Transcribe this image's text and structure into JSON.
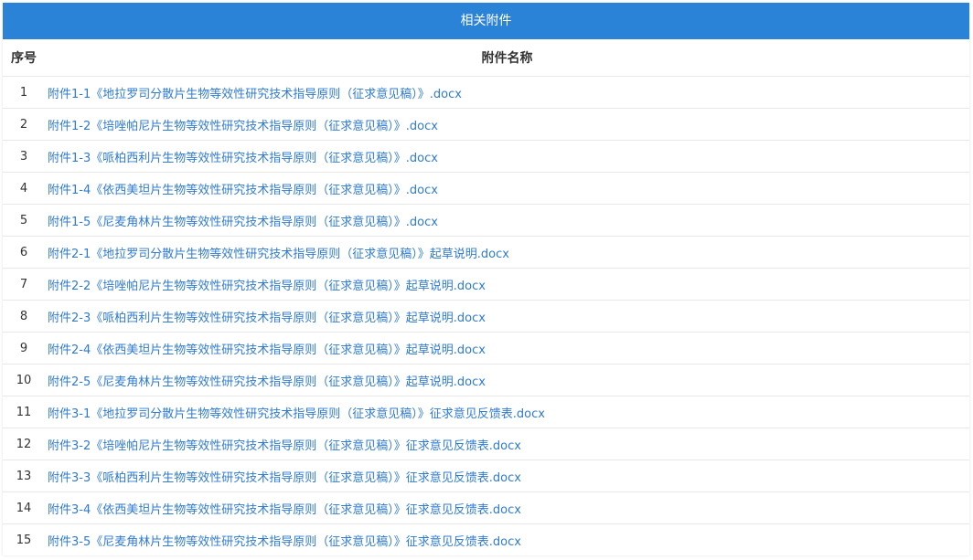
{
  "panel": {
    "title": "相关附件"
  },
  "table": {
    "headers": {
      "number": "序号",
      "name": "附件名称"
    },
    "rows": [
      {
        "number": "1",
        "name": "附件1-1《地拉罗司分散片生物等效性研究技术指导原则（征求意见稿）》.docx"
      },
      {
        "number": "2",
        "name": "附件1-2《培唑帕尼片生物等效性研究技术指导原则（征求意见稿）》.docx"
      },
      {
        "number": "3",
        "name": "附件1-3《哌柏西利片生物等效性研究技术指导原则（征求意见稿）》.docx"
      },
      {
        "number": "4",
        "name": "附件1-4《依西美坦片生物等效性研究技术指导原则（征求意见稿）》.docx"
      },
      {
        "number": "5",
        "name": "附件1-5《尼麦角林片生物等效性研究技术指导原则（征求意见稿）》.docx"
      },
      {
        "number": "6",
        "name": "附件2-1《地拉罗司分散片生物等效性研究技术指导原则（征求意见稿）》起草说明.docx"
      },
      {
        "number": "7",
        "name": "附件2-2《培唑帕尼片生物等效性研究技术指导原则（征求意见稿）》起草说明.docx"
      },
      {
        "number": "8",
        "name": "附件2-3《哌柏西利片生物等效性研究技术指导原则（征求意见稿）》起草说明.docx"
      },
      {
        "number": "9",
        "name": "附件2-4《依西美坦片生物等效性研究技术指导原则（征求意见稿）》起草说明.docx"
      },
      {
        "number": "10",
        "name": "附件2-5《尼麦角林片生物等效性研究技术指导原则（征求意见稿）》起草说明.docx"
      },
      {
        "number": "11",
        "name": "附件3-1《地拉罗司分散片生物等效性研究技术指导原则（征求意见稿）》征求意见反馈表.docx"
      },
      {
        "number": "12",
        "name": "附件3-2《培唑帕尼片生物等效性研究技术指导原则（征求意见稿）》征求意见反馈表.docx"
      },
      {
        "number": "13",
        "name": "附件3-3《哌柏西利片生物等效性研究技术指导原则（征求意见稿）》征求意见反馈表.docx"
      },
      {
        "number": "14",
        "name": "附件3-4《依西美坦片生物等效性研究技术指导原则（征求意见稿）》征求意见反馈表.docx"
      },
      {
        "number": "15",
        "name": "附件3-5《尼麦角林片生物等效性研究技术指导原则（征求意见稿）》征求意见反馈表.docx"
      }
    ]
  },
  "colors": {
    "header_bg": "#2b83d8",
    "link": "#2f7bd1",
    "text": "#333333",
    "divider": "#e8e8e8"
  }
}
